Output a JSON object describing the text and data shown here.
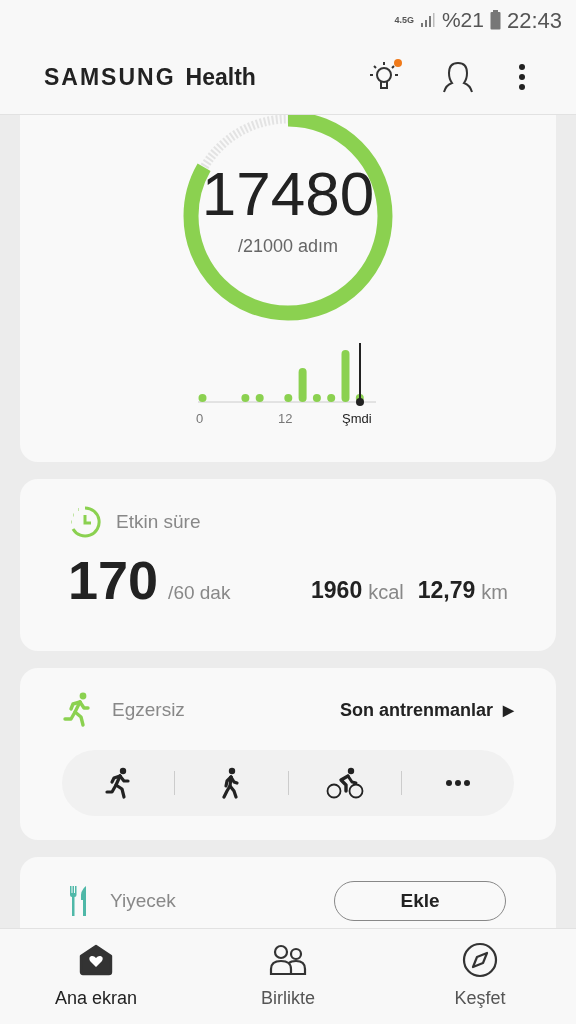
{
  "status_bar": {
    "network": "4.5G",
    "battery": "%21",
    "time": "22:43"
  },
  "header": {
    "brand": "SAMSUNG",
    "app": "Health",
    "tips_has_notification": true
  },
  "steps": {
    "count": "17480",
    "goal": "/21000 adım",
    "axis_labels": [
      "0",
      "12",
      "Şmdi"
    ]
  },
  "active_time": {
    "title": "Etkin süre",
    "value": "170",
    "goal": "/60 dak",
    "calories": "1960",
    "calories_unit": "kcal",
    "distance": "12,79",
    "distance_unit": "km"
  },
  "exercise": {
    "title": "Egzersiz",
    "link": "Son antrenmanlar",
    "link_arrow": "▶",
    "shortcuts": [
      {
        "kind": "run"
      },
      {
        "kind": "walk"
      },
      {
        "kind": "bike"
      },
      {
        "kind": "more"
      }
    ]
  },
  "food": {
    "title": "Yiyecek",
    "button": "Ekle"
  },
  "bottom_nav": [
    {
      "kind": "home",
      "label": "Ana ekran",
      "selected": true
    },
    {
      "kind": "together",
      "label": "Birlikte",
      "selected": false
    },
    {
      "kind": "discover",
      "label": "Keşfet",
      "selected": false
    }
  ]
}
